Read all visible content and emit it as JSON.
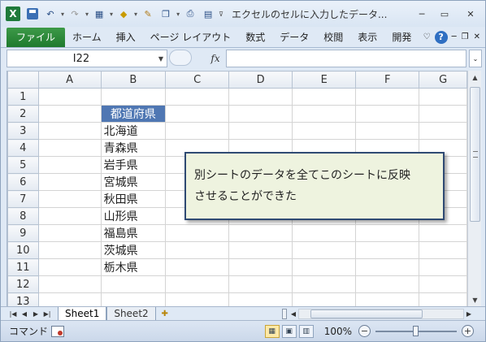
{
  "window": {
    "title": "エクセルのセルに入力したデータ..."
  },
  "ribbon": {
    "file_tab": "ファイル",
    "tabs": [
      "ホーム",
      "挿入",
      "ページ レイアウト",
      "数式",
      "データ",
      "校閲",
      "表示",
      "開発"
    ]
  },
  "formula_bar": {
    "name_box": "I22",
    "fx_label": "fx",
    "formula": ""
  },
  "sheet": {
    "columns": [
      "A",
      "B",
      "C",
      "D",
      "E",
      "F",
      "G"
    ],
    "rows": [
      "1",
      "2",
      "3",
      "4",
      "5",
      "6",
      "7",
      "8",
      "9",
      "10",
      "11",
      "12",
      "13"
    ],
    "b_column": {
      "header": "都道府県",
      "values": [
        "北海道",
        "青森県",
        "岩手県",
        "宮城県",
        "秋田県",
        "山形県",
        "福島県",
        "茨城県",
        "栃木県"
      ]
    }
  },
  "callout": {
    "line1": "別シートのデータを全てこのシートに反映",
    "line2": "させることができた"
  },
  "sheet_tabs": [
    "Sheet1",
    "Sheet2"
  ],
  "status": {
    "mode": "コマンド",
    "zoom": "100%"
  },
  "colors": {
    "header_fill": "#4f77b3",
    "callout_fill": "#eef3df",
    "callout_border": "#2f4a73",
    "file_tab": "#2a8a3a"
  }
}
